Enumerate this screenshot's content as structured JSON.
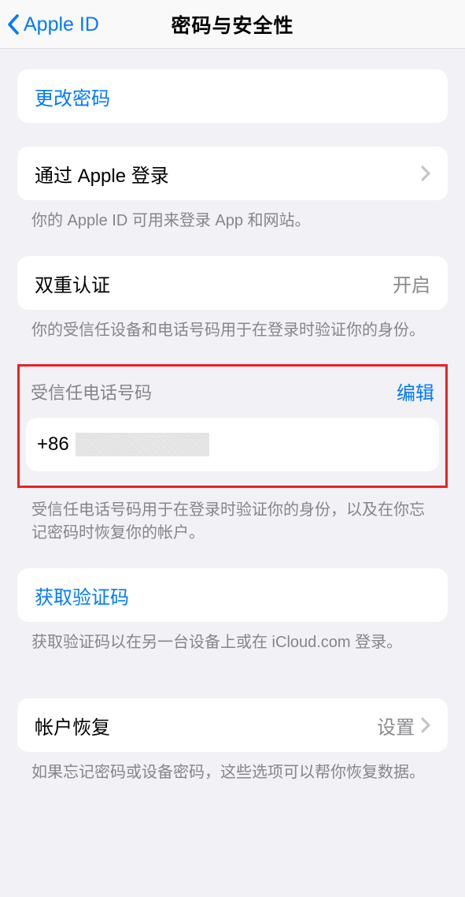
{
  "nav": {
    "back_label": "Apple ID",
    "title": "密码与安全性"
  },
  "change_password": {
    "label": "更改密码"
  },
  "sign_in_with_apple": {
    "label": "通过 Apple 登录",
    "footer": "你的 Apple ID 可用来登录 App 和网站。"
  },
  "two_factor": {
    "label": "双重认证",
    "status": "开启",
    "footer": "你的受信任设备和电话号码用于在登录时验证你的身份。"
  },
  "trusted_phone": {
    "header": "受信任电话号码",
    "edit": "编辑",
    "prefix": "+86",
    "footer": "受信任电话号码用于在登录时验证你的身份，以及在你忘记密码时恢复你的帐户。"
  },
  "get_code": {
    "label": "获取验证码",
    "footer": "获取验证码以在另一台设备上或在 iCloud.com 登录。"
  },
  "account_recovery": {
    "label": "帐户恢复",
    "detail": "设置",
    "footer": "如果忘记密码或设备密码，这些选项可以帮你恢复数据。"
  }
}
